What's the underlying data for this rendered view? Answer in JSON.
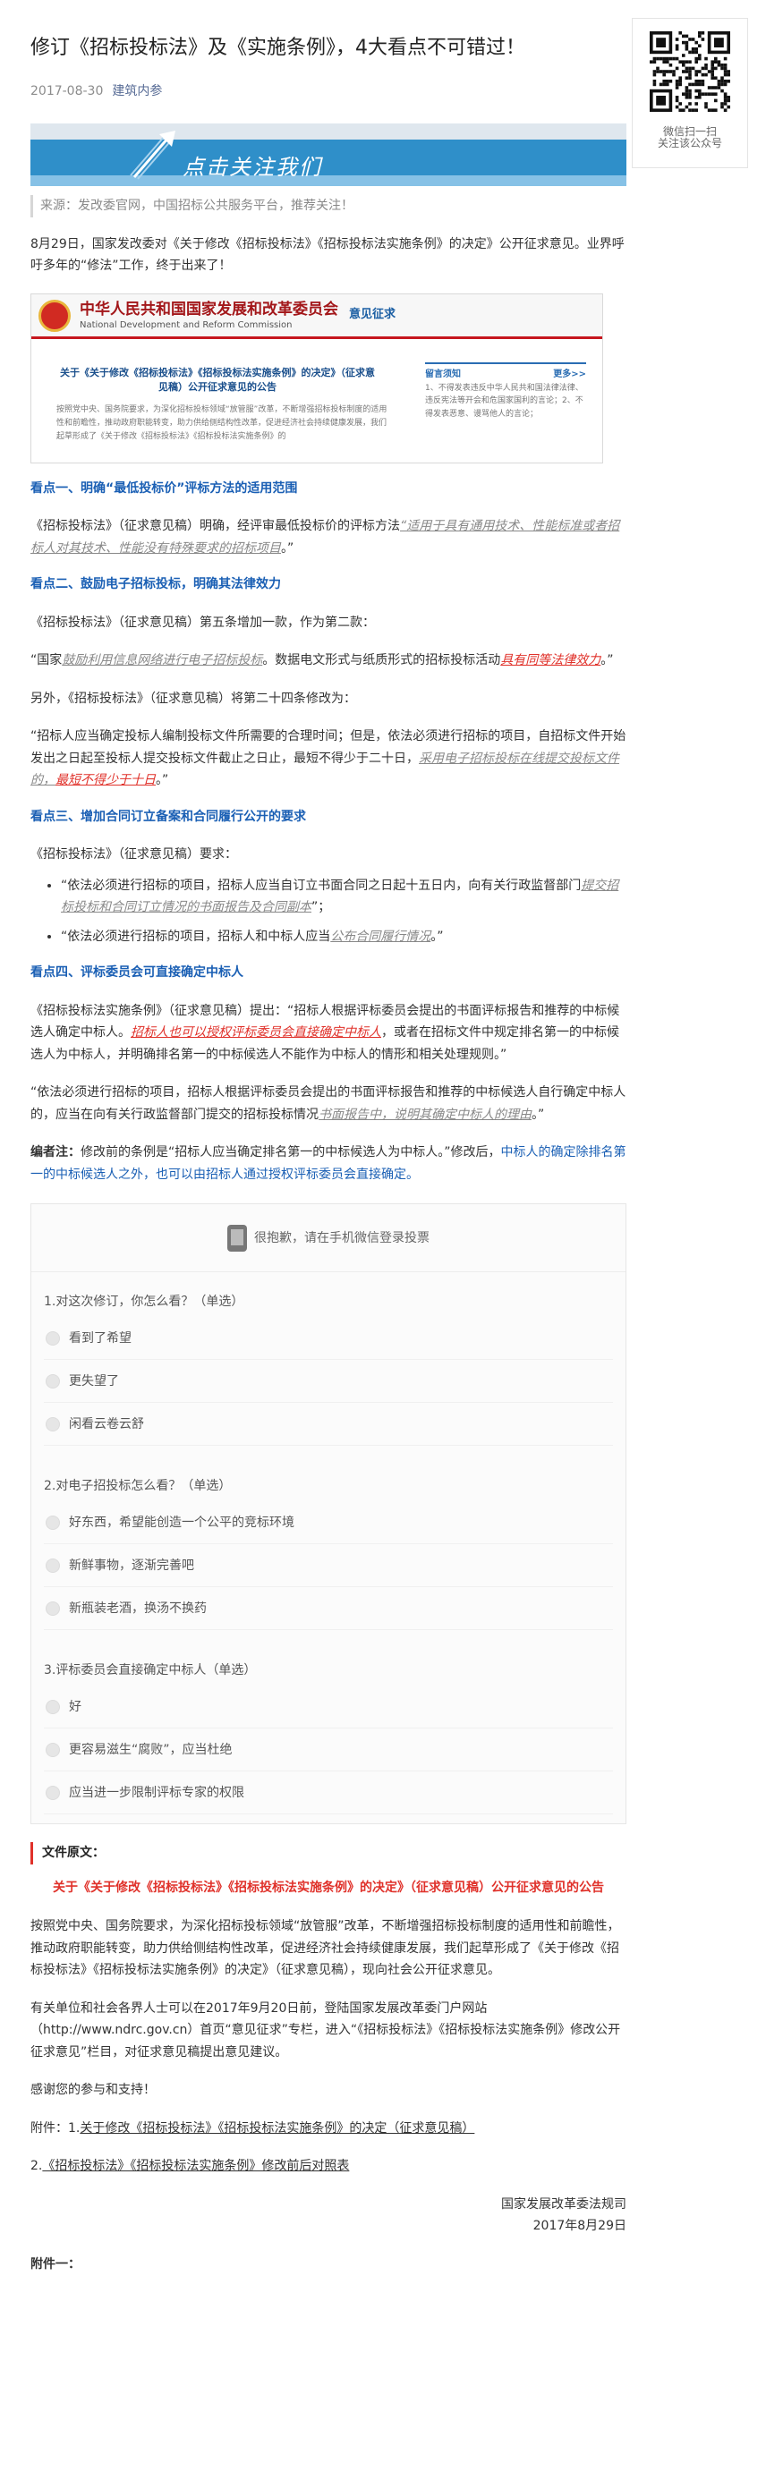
{
  "title": "修订《招标投标法》及《实施条例》，4大看点不可错过！",
  "date": "2017-08-30",
  "account": "建筑内参",
  "banner_text": "点击关注我们",
  "source": "来源：发改委官网，中国招标公共服务平台，推荐关注！",
  "intro": "8月29日，国家发改委对《关于修改《招标投标法》《招标投标法实施条例》的决定》公开征求意见。业界呼吁多年的“修法”工作，终于出来了！",
  "notice_image": {
    "org_cn": "中华人民共和国国家发展和改革委员会",
    "org_en": "National Development and Reform Commission",
    "section": "意见征求",
    "doc_title": "关于《关于修改《招标投标法》《招标投标法实施条例》的决定》（征求意见稿）公开征求意见的公告",
    "doc_body": "按照党中央、国务院要求，为深化招标投标领域“放管服”改革，不断增强招标投标制度的适用性和前瞻性，推动政府职能转变，助力供给侧结构性改革，促进经济社会持续健康发展，我们起草形成了《关于修改《招标投标法》《招标投标法实施条例》的",
    "side_title": "留言须知",
    "side_more": "更多>>",
    "side_text": "1、不得发表违反中华人民共和国法律法律、违反宪法等开会和危国家国利的言论；2、不得发表恶意、谩骂他人的言论；"
  },
  "s1": {
    "heading": "看点一、明确“最低投标价”评标方法的适用范围",
    "p1_a": "《招标投标法》（征求意见稿）明确，经评审最低投标价的评标方法",
    "p1_u": "“适用于具有通用技术、性能标准或者招标人对其技术、性能没有特殊要求的招标项目",
    "p1_b": "。”"
  },
  "s2": {
    "heading": "看点二、鼓励电子招标投标，明确其法律效力",
    "p1": "《招标投标法》（征求意见稿）第五条增加一款，作为第二款：",
    "p2_a": "“国家",
    "p2_u1": "鼓励利用信息网络进行电子招标投标",
    "p2_b": "。数据电文形式与纸质形式的招标投标活动",
    "p2_u2": "具有同等法律效力",
    "p2_c": "。”",
    "p3": "另外，《招标投标法》（征求意见稿）将第二十四条修改为：",
    "p4_a": "“招标人应当确定投标人编制投标文件所需要的合理时间；但是，依法必须进行招标的项目，自招标文件开始发出之日起至投标人提交投标文件截止之日止，最短不得少于二十日，",
    "p4_u1": "采用电子招标投标在线提交投标文件的，",
    "p4_u2": "最短不得少于十日",
    "p4_b": "。”"
  },
  "s3": {
    "heading": "看点三、增加合同订立备案和合同履行公开的要求",
    "p1": "《招标投标法》（征求意见稿）要求：",
    "li1_a": "“依法必须进行招标的项目，招标人应当自订立书面合同之日起十五日内，向有关行政监督部门",
    "li1_u": "提交招标投标和合同订立情况的书面报告及合同副本",
    "li1_b": "”；",
    "li2_a": "“依法必须进行招标的项目，招标人和中标人应当",
    "li2_u": "公布合同履行情况",
    "li2_b": "。”"
  },
  "s4": {
    "heading": "看点四、评标委员会可直接确定中标人",
    "p1_a": "《招标投标法实施条例》（征求意见稿）提出：“招标人根据评标委员会提出的书面评标报告和推荐的中标候选人确定中标人。",
    "p1_u": "招标人也可以授权评标委员会直接确定中标人",
    "p1_b": "，或者在招标文件中规定排名第一的中标候选人为中标人，并明确排名第一的中标候选人不能作为中标人的情形和相关处理规则。”",
    "p2_a": "“依法必须进行招标的项目，招标人根据评标委员会提出的书面评标报告和推荐的中标候选人自行确定中标人的，应当在向有关行政监督部门提交的招标投标情况",
    "p2_u": "书面报告中，说明其确定中标人的理由",
    "p2_b": "。”",
    "note_label": "编者注：",
    "note_a": "修改前的条例是“招标人应当确定排名第一的中标候选人为中标人。”修改后，",
    "note_b": "中标人的确定除排名第一的中标候选人之外，也可以由招标人通过授权评标委员会直接确定。"
  },
  "vote": {
    "notice": "很抱歉，请在手机微信登录投票",
    "questions": [
      {
        "q": "1.对这次修订，你怎么看？（单选）",
        "options": [
          "看到了希望",
          "更失望了",
          "闲看云卷云舒"
        ]
      },
      {
        "q": "2.对电子招投标怎么看？（单选）",
        "options": [
          "好东西，希望能创造一个公平的竞标环境",
          "新鲜事物，逐渐完善吧",
          "新瓶装老酒，换汤不换药"
        ]
      },
      {
        "q": "3.评标委员会直接确定中标人（单选）",
        "options": [
          "好",
          "更容易滋生“腐败”，应当杜绝",
          "应当进一步限制评标专家的权限"
        ]
      }
    ]
  },
  "original": {
    "label": "文件原文：",
    "title": "关于《关于修改《招标投标法》《招标投标法实施条例》的决定》（征求意见稿）公开征求意见的公告",
    "p1": "按照党中央、国务院要求，为深化招标投标领域“放管服”改革，不断增强招标投标制度的适用性和前瞻性，推动政府职能转变，助力供给侧结构性改革，促进经济社会持续健康发展，我们起草形成了《关于修改《招标投标法》《招标投标法实施条例》的决定》（征求意见稿），现向社会公开征求意见。",
    "p2": "有关单位和社会各界人士可以在2017年9月20日前，登陆国家发展改革委门户网站（http://www.ndrc.gov.cn）首页“意见征求”专栏，进入“《招标投标法》《招标投标法实施条例》修改公开征求意见”栏目，对征求意见稿提出意见建议。",
    "p3": "感谢您的参与和支持！",
    "att_prefix": "附件：1.",
    "att1": "关于修改《招标投标法》《招标投标法实施条例》的决定（征求意见稿）",
    "att2_prefix": "2.",
    "att2": "《招标投标法》《招标投标法实施条例》修改前后对照表",
    "sign": "国家发展改革委法规司",
    "sign_date": "2017年8月29日",
    "annex": "附件一："
  },
  "qr": {
    "line1": "微信扫一扫",
    "line2": "关注该公众号"
  }
}
